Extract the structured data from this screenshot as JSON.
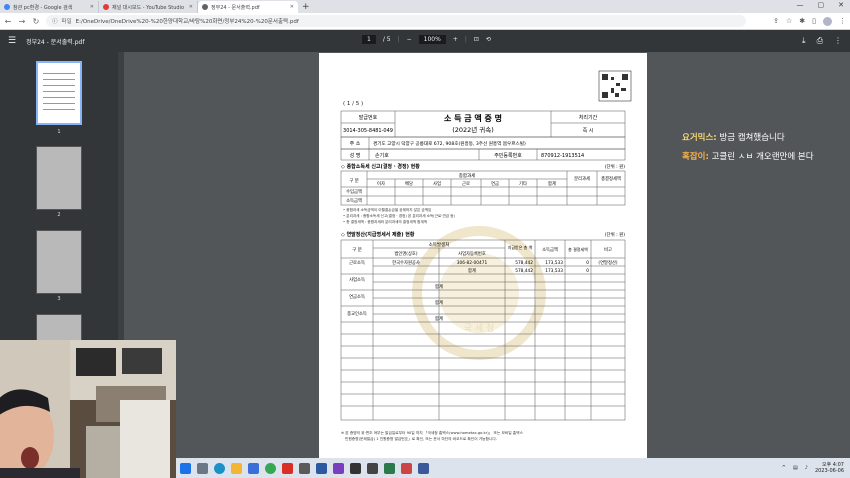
{
  "tabs": [
    {
      "label": "참관 pc환경 - Google 검색",
      "color": "#4285f4"
    },
    {
      "label": "채널 대시보드 - YouTube Studio",
      "color": "#e53935"
    },
    {
      "label": "정부24 - 문서출력.pdf",
      "color": "#5f6368"
    }
  ],
  "new_tab": "+",
  "window_controls": [
    "—",
    "▢",
    "✕"
  ],
  "address": {
    "label": "파일",
    "url": "E:/OneDrive/OneDrive%20-%20한양대학교/바탕%20화면/정부24%20-%20문서출력.pdf"
  },
  "pdf_toolbar": {
    "title": "정부24 - 문서출력.pdf",
    "page": "1",
    "total": "/ 5",
    "zoom": "100%"
  },
  "thumbnails": [
    "1",
    "2",
    "3"
  ],
  "document": {
    "page_indicator": "( 1 / 5 )",
    "issue_number_label": "발급번호",
    "issue_number": "3014-305-8481-049",
    "title": "소 득 금 액 증 명",
    "subtitle": "(2022년 귀속)",
    "processing_label": "처리기간",
    "processing_value": "즉  시",
    "address_label": "주  소",
    "address_value": "경기도 고양시 덕양구 공릉대로 672, 908호(원흥동, 3주선 원흥역 봄우르스빌)",
    "name_label": "성  명",
    "name_value": "손기호",
    "rrn_label": "주민등록번호",
    "rrn_value": "870912-1913514",
    "section1": "◇ 종합소득세 신고(결정 · 경정) 현황",
    "unit": "(단위 : 원)",
    "s1_headers": [
      "구  분",
      "종합과세",
      "분리과세",
      "총결정세액"
    ],
    "s1_sub": [
      "이자",
      "배당",
      "사업",
      "근로",
      "연금",
      "기타",
      "합계"
    ],
    "s1_rows": [
      "수입금액",
      "소득금액"
    ],
    "notes": [
      "• 종합과세 소득금액이 이월결손금을 공제하지 않은 금액임",
      "• 분리과세 : 종합소득세 신고(결정 · 경정) 된 분리과세 소득(근로·연금 등)",
      "• 총 결정세액 : 종합과세와 분리과세의 결정세액 합계액"
    ],
    "section2": "◇ 연말정산(지급명세서 제출) 현황",
    "s2_headers": [
      "구  분",
      "소득발생처",
      "법인명(상호)",
      "사업자등록번호",
      "지급받은 총 액",
      "소득금액",
      "총 결정세액",
      "비고"
    ],
    "s2_rows": [
      {
        "type": "근로소득",
        "company": "한국수자원공사",
        "brn": "306-82-00471",
        "paid": "578,442",
        "income": "173,533",
        "tax": "0",
        "note": "(연말정산)"
      },
      {
        "type": "",
        "company": "",
        "brn": "합계",
        "paid": "578,442",
        "income": "173,533",
        "tax": "0",
        "note": ""
      }
    ],
    "s2_types": [
      "사업소득",
      "연금소득",
      "종교인소득"
    ],
    "sum_label": "합계",
    "watermark": "국 세 청",
    "footer": [
      "※ 본 증명의 위·변조 여부는 발급일로부터 90일 까지 「국세청 홈택스(www.hometax.go.kr)」 또는 모바일 홈택스",
      "민원증명(문제발급) 1 진원증명 발급번호」로 확인, 또는 문서 하단의 바코드로 확인이 가능합니다."
    ]
  },
  "chat": [
    {
      "name": "요거믹스:",
      "text": " 방금 캡쳐했습니다"
    },
    {
      "name": "혹잡이:",
      "text": " 고클린 ㅅㅂ 개오랜만에 본다"
    }
  ],
  "taskbar": {
    "time": "오후 4:07",
    "date": "2023-06-06"
  }
}
